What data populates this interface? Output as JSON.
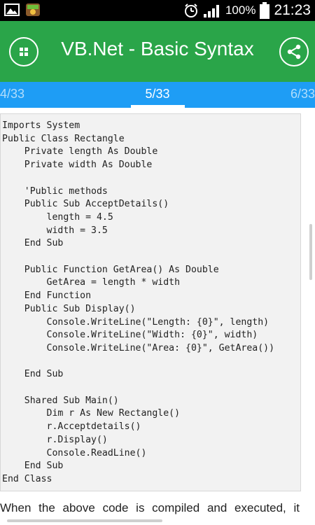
{
  "status_bar": {
    "battery": "100%",
    "time": "21:23"
  },
  "app_bar": {
    "title": "VB.Net - Basic Syntax",
    "menu_icon": "grid-dots-icon",
    "share_icon": "share-icon",
    "color": "#2aa549"
  },
  "tabs": {
    "prev": "4/33",
    "current": "5/33",
    "next": "6/33",
    "color": "#1e9df5"
  },
  "code_lines": [
    "Imports System",
    "Public Class Rectangle",
    "    Private length As Double",
    "    Private width As Double",
    "",
    "    'Public methods",
    "    Public Sub AcceptDetails()",
    "        length = 4.5",
    "        width = 3.5",
    "    End Sub",
    "",
    "    Public Function GetArea() As Double",
    "        GetArea = length * width",
    "    End Function",
    "    Public Sub Display()",
    "        Console.WriteLine(\"Length: {0}\", length)",
    "        Console.WriteLine(\"Width: {0}\", width)",
    "        Console.WriteLine(\"Area: {0}\", GetArea())",
    "",
    "    End Sub",
    "",
    "    Shared Sub Main()",
    "        Dim r As New Rectangle()",
    "        r.Acceptdetails()",
    "        r.Display()",
    "        Console.ReadLine()",
    "    End Sub",
    "End Class"
  ],
  "description": "When the above code is compiled and executed, it"
}
